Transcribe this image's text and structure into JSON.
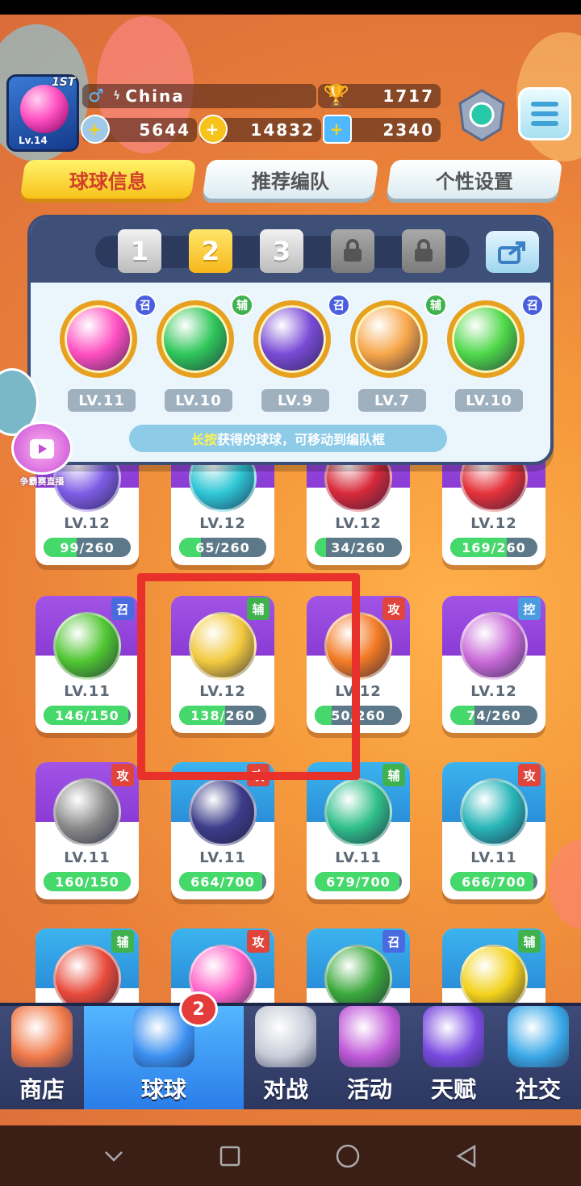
{
  "player": {
    "level_label": "Lv.14",
    "rank_tag": "1ST",
    "name": "China",
    "trophies": "1717",
    "stamina": "5644",
    "coins": "14832",
    "gems": "2340"
  },
  "tabs": [
    {
      "label": "球球信息",
      "active": true
    },
    {
      "label": "推荐编队",
      "active": false
    },
    {
      "label": "个性设置",
      "active": false
    }
  ],
  "team": {
    "slots": [
      "1",
      "2",
      "3",
      "locked",
      "locked"
    ],
    "active_slot": "2",
    "members": [
      {
        "badge": "召",
        "level": "LV.11",
        "color": "#ff4fc1"
      },
      {
        "badge": "辅",
        "level": "LV.10",
        "color": "#2fc75a"
      },
      {
        "badge": "召",
        "level": "LV.9",
        "color": "#7a4bd6"
      },
      {
        "badge": "辅",
        "level": "LV.7",
        "color": "#f7a64a"
      },
      {
        "badge": "召",
        "level": "LV.10",
        "color": "#4fd84a"
      }
    ],
    "hint_highlight": "长按",
    "hint_text": "获得的球球，可移动到编队框"
  },
  "live": {
    "caption": "争霸赛直播"
  },
  "collection": [
    {
      "level": "LV.12",
      "progress": "99/260",
      "fill": 0.38,
      "header": "purple",
      "color": "#7e5ce6"
    },
    {
      "level": "LV.12",
      "progress": "65/260",
      "fill": 0.25,
      "header": "purple",
      "color": "#2ec7d6"
    },
    {
      "level": "LV.12",
      "progress": "34/260",
      "fill": 0.13,
      "header": "purple",
      "color": "#d8293a"
    },
    {
      "level": "LV.12",
      "progress": "169/260",
      "fill": 0.65,
      "header": "purple",
      "color": "#e4323a"
    },
    {
      "level": "LV.11",
      "progress": "146/150",
      "fill": 0.97,
      "header": "purple",
      "color": "#4fc531",
      "tag": "召",
      "tag_color": "#4a6be0"
    },
    {
      "level": "LV.12",
      "progress": "138/260",
      "fill": 0.53,
      "header": "purple",
      "color": "#f2c93e",
      "tag": "辅",
      "tag_color": "#3fb24f"
    },
    {
      "level": "LV.12",
      "progress": "50/260",
      "fill": 0.19,
      "header": "purple",
      "color": "#f27a24",
      "tag": "攻",
      "tag_color": "#e0443a"
    },
    {
      "level": "LV.12",
      "progress": "74/260",
      "fill": 0.28,
      "header": "purple",
      "color": "#c86ad8",
      "tag": "控",
      "tag_color": "#4a9be0"
    },
    {
      "level": "LV.11",
      "progress": "160/150",
      "fill": 1.0,
      "header": "purple",
      "color": "#8a8a8a",
      "tag": "攻",
      "tag_color": "#e0443a"
    },
    {
      "level": "LV.11",
      "progress": "664/700",
      "fill": 0.95,
      "header": "blue",
      "color": "#3c3c8a",
      "tag": "攻",
      "tag_color": "#e0443a"
    },
    {
      "level": "LV.11",
      "progress": "679/700",
      "fill": 0.97,
      "header": "blue",
      "color": "#2fbf8a",
      "tag": "辅",
      "tag_color": "#3fb24f"
    },
    {
      "level": "LV.11",
      "progress": "666/700",
      "fill": 0.95,
      "header": "blue",
      "color": "#28b5b8",
      "tag": "攻",
      "tag_color": "#e0443a"
    },
    {
      "level": "",
      "progress": "",
      "fill": 0,
      "header": "blue",
      "color": "#e84a3a",
      "tag": "辅",
      "tag_color": "#3fb24f"
    },
    {
      "level": "",
      "progress": "",
      "fill": 0,
      "header": "blue",
      "color": "#ff62c8",
      "tag": "攻",
      "tag_color": "#e0443a"
    },
    {
      "level": "",
      "progress": "",
      "fill": 0,
      "header": "blue",
      "color": "#3aa83a",
      "tag": "召",
      "tag_color": "#4a6be0"
    },
    {
      "level": "",
      "progress": "",
      "fill": 0,
      "header": "blue",
      "color": "#f2d21a",
      "tag": "辅",
      "tag_color": "#3fb24f"
    }
  ],
  "nav": {
    "items": [
      {
        "label": "商店",
        "icon": "shop-icon",
        "active": false
      },
      {
        "label": "球球",
        "icon": "balls-icon",
        "active": true
      },
      {
        "label": "对战",
        "icon": "crossed-swords-icon",
        "active": false
      },
      {
        "label": "活动",
        "icon": "party-popper-icon",
        "active": false
      },
      {
        "label": "天赋",
        "icon": "planet-icon",
        "active": false
      },
      {
        "label": "社交",
        "icon": "chat-heart-icon",
        "active": false
      }
    ],
    "badge": "2"
  },
  "colors": {
    "accent_yellow": "#f7c21a",
    "highlight_red": "#e8312a",
    "nav_bg": "#3e4b78"
  }
}
